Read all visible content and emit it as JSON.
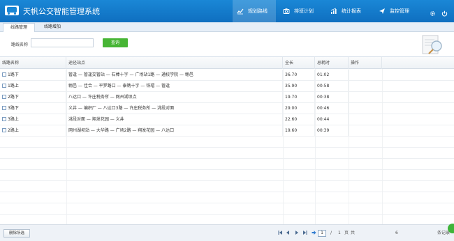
{
  "app": {
    "title": "天帆公交智能管理系统"
  },
  "nav": [
    {
      "label": "规划路线",
      "icon": "chart-line-icon"
    },
    {
      "label": "排班计划",
      "icon": "camera-icon"
    },
    {
      "label": "统计报表",
      "icon": "bar-chart-icon"
    },
    {
      "label": "监控管理",
      "icon": "send-icon"
    }
  ],
  "window": {
    "settings_icon": "gear-icon",
    "power_icon": "power-icon"
  },
  "subtabs": [
    {
      "label": "线路管理"
    },
    {
      "label": "线路增加"
    }
  ],
  "search": {
    "label": "路线名称",
    "value": "",
    "placeholder": "",
    "button": "查询"
  },
  "table": {
    "columns": [
      "线路名称",
      "途径站点",
      "全长",
      "总耗时",
      "操作"
    ],
    "rows": [
      {
        "name": "1路下",
        "stops": "管逢 — 管逢交管站 — 石棒十字 — 广场站1路 — 通校学院 — 翱邑",
        "length": "36.70",
        "time": "01:02"
      },
      {
        "name": "1路上",
        "stops": "翱邑 — 佳合 — 平罗路口 — 泰镌十字 — 铁瑁 — 管逢",
        "length": "35.90",
        "time": "00:58"
      },
      {
        "name": "2路下",
        "stops": "八达口 — 许庄税务所 — 网州湖坝点",
        "length": "19.70",
        "time": "00:38"
      },
      {
        "name": "3路下",
        "stops": "义井 — 编织厂 — 八达口3路 — 许庄税务所 — 洮段对面",
        "length": "29.00",
        "time": "00:46"
      },
      {
        "name": "3路上",
        "stops": "洮段对面 — 翔发花园 — 义井",
        "length": "22.60",
        "time": "00:44"
      },
      {
        "name": "2路上",
        "stops": "网州湖坝站 — 大华路 — 广场2路 — 翔发花园 — 八达口",
        "length": "19.60",
        "time": "00:39"
      }
    ]
  },
  "footer": {
    "delete_button": "删除所选",
    "page_current": "1",
    "page_sep": "/",
    "page_total": "1",
    "page_unit": "页",
    "total_label": "共",
    "total_count": "6",
    "records_label": "条记录"
  },
  "colors": {
    "header": "#1a87d6",
    "accent_green": "#47b535"
  }
}
